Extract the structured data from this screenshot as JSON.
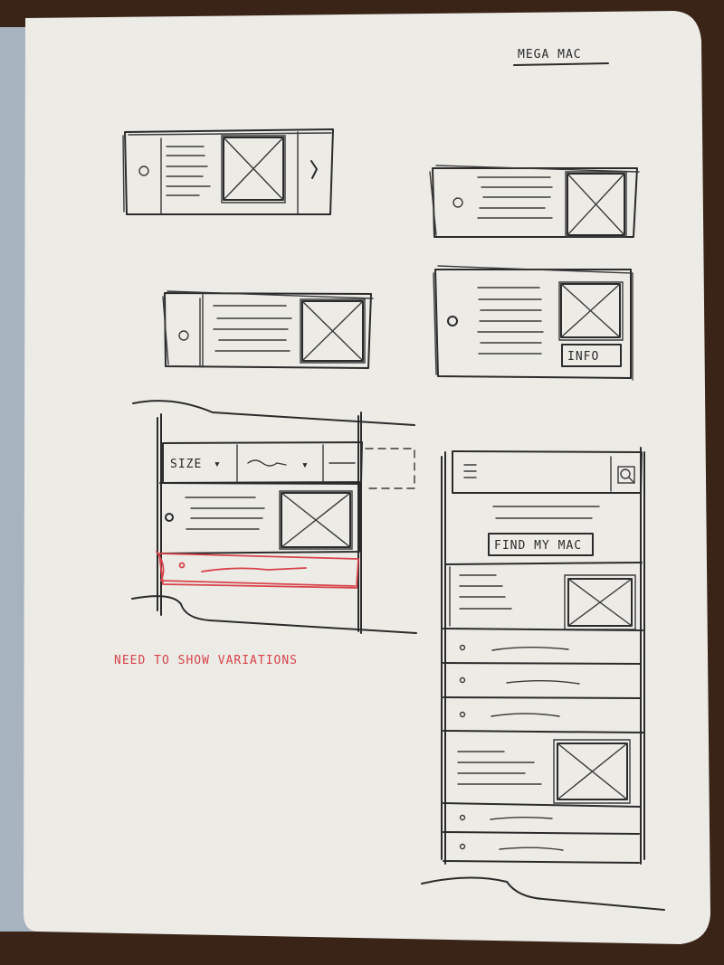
{
  "sheet": {
    "title": "MEGA MAC",
    "note": "NEED TO SHOW VARIATIONS",
    "colors": {
      "paper": "#ecebe6",
      "ink": "#2b2b2b",
      "red_pen": "#d8434b",
      "desk": "#3a2418"
    }
  },
  "filter_bar": {
    "size_label": "SIZE",
    "size_arrow": "▾",
    "second_arrow": "▾"
  },
  "cards": {
    "info_button": "INFO",
    "find_button": "FIND MY MAC"
  },
  "icons": [
    "menu-icon",
    "search-icon",
    "image-placeholder-icon",
    "chevron-right-icon",
    "bullet-icon"
  ]
}
